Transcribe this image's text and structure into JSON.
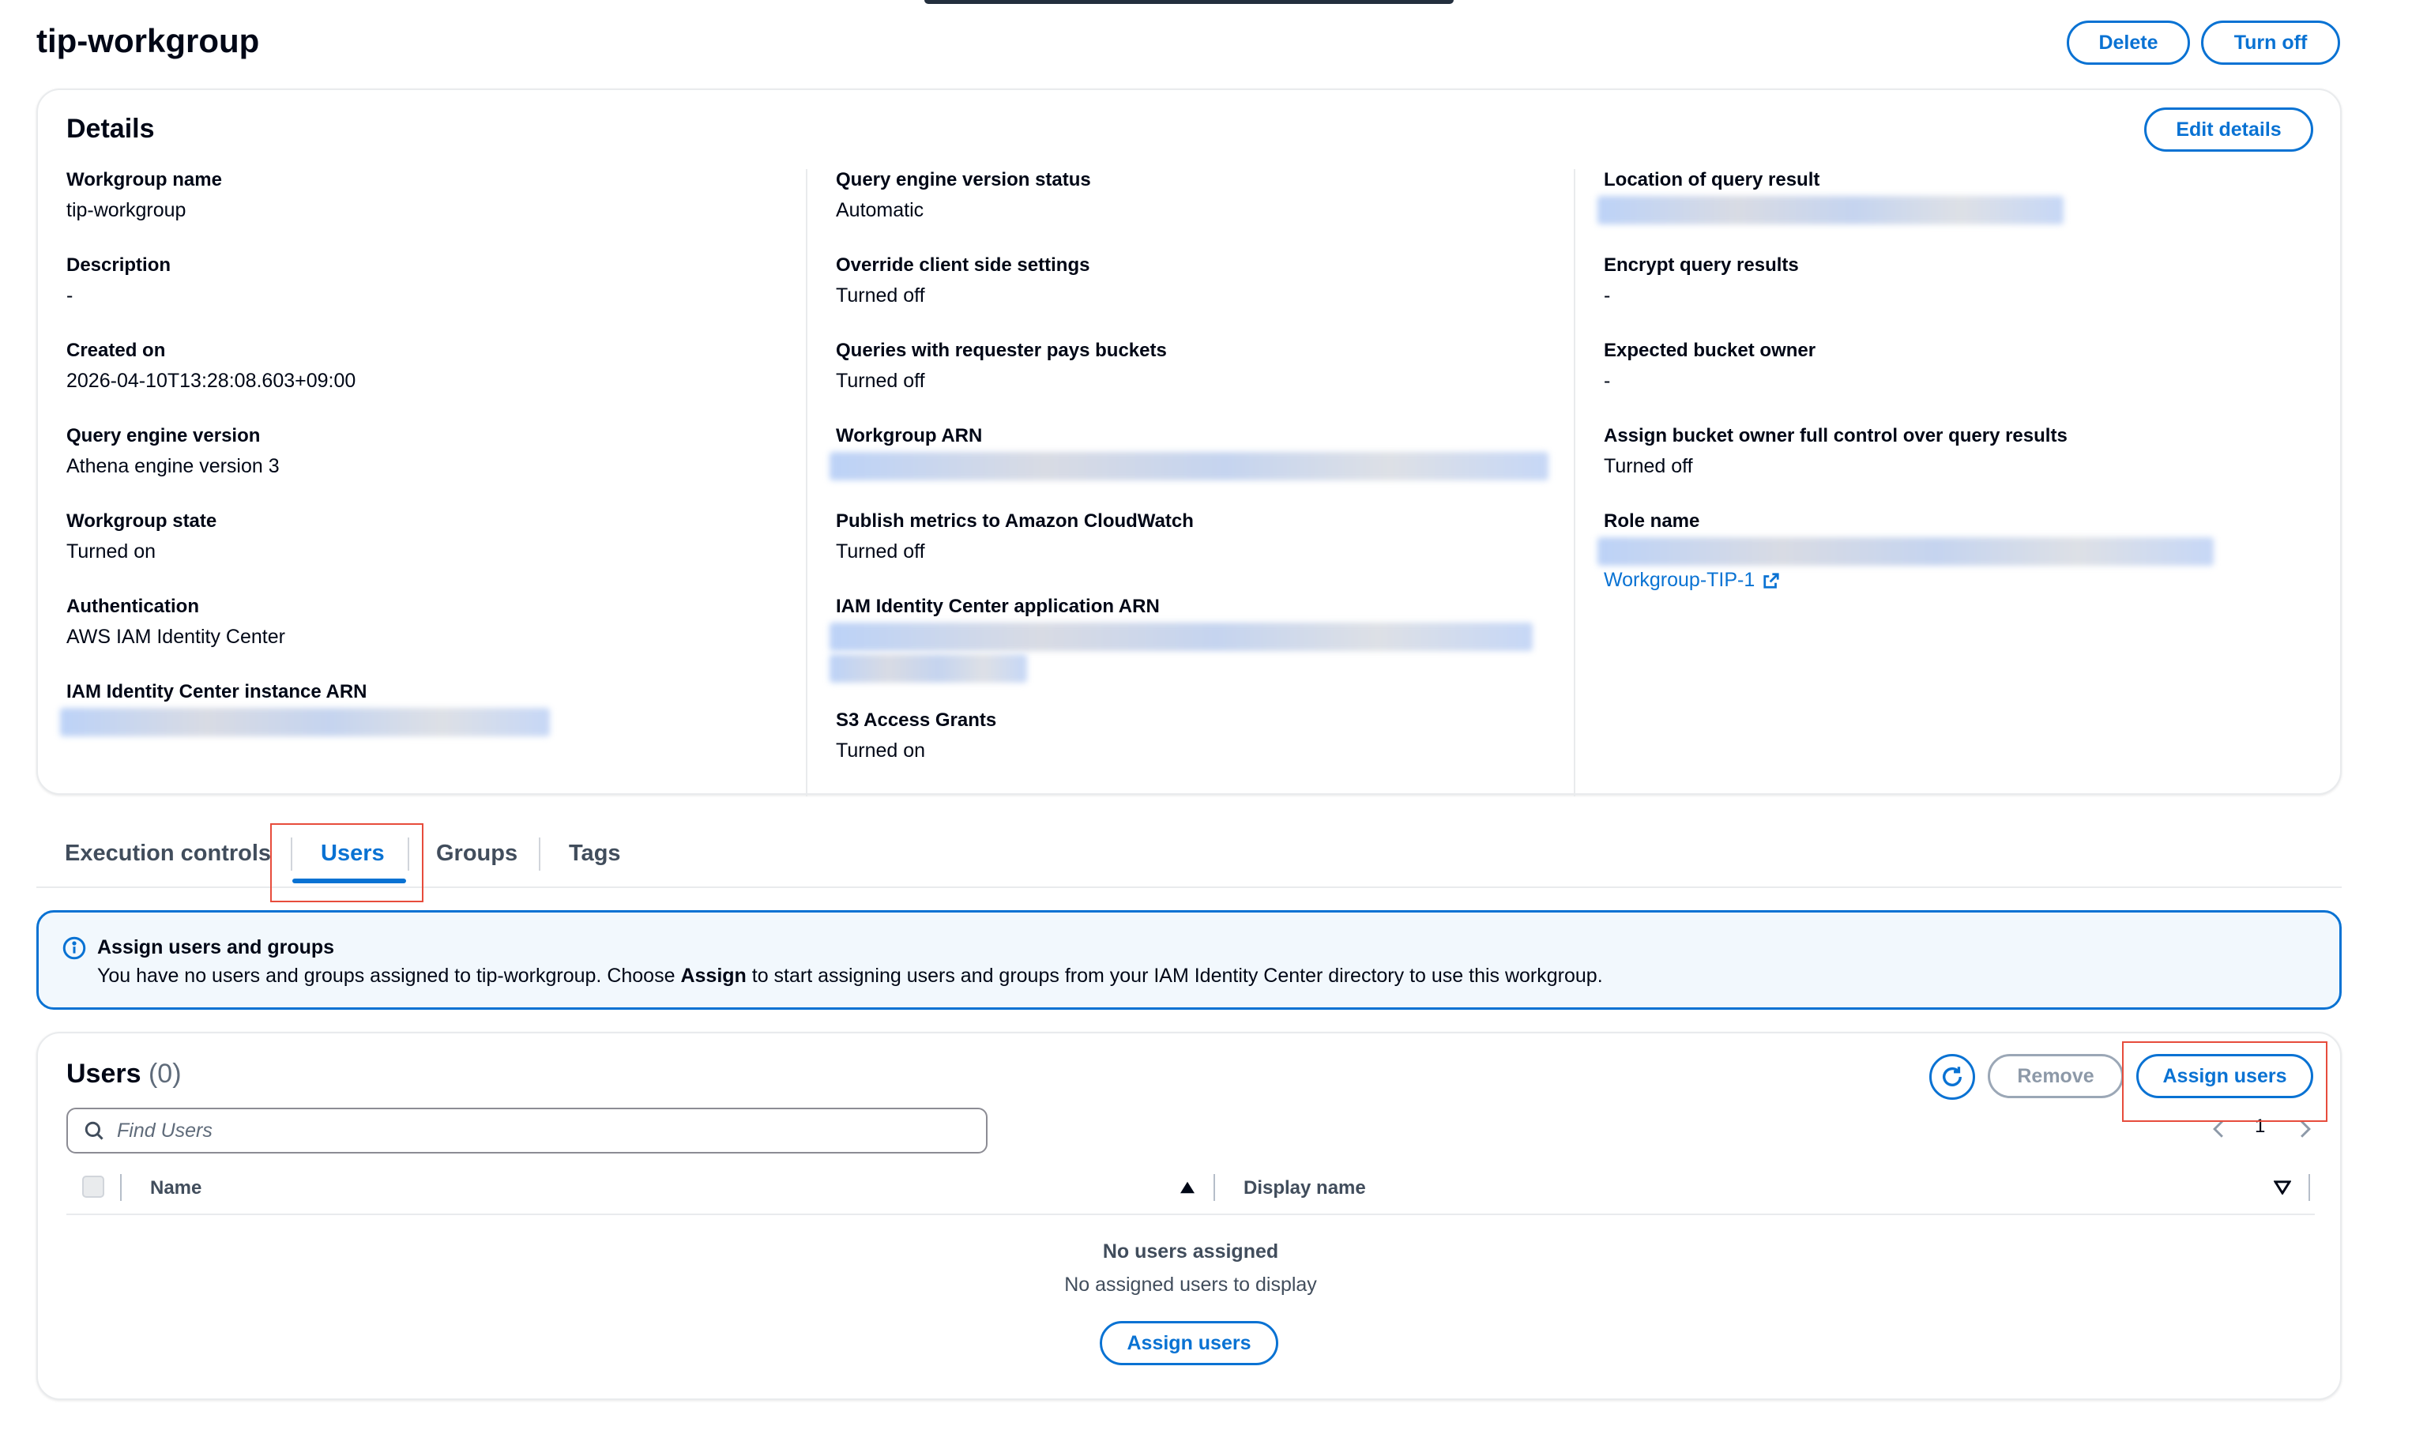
{
  "page": {
    "title": "tip-workgroup",
    "delete_label": "Delete",
    "turn_off_label": "Turn off"
  },
  "details": {
    "heading": "Details",
    "edit_label": "Edit details",
    "col1": [
      {
        "label": "Workgroup name",
        "value": "tip-workgroup"
      },
      {
        "label": "Description",
        "value": "-"
      },
      {
        "label": "Created on",
        "value": "2026-04-10T13:28:08.603+09:00"
      },
      {
        "label": "Query engine version",
        "value": "Athena engine version 3"
      },
      {
        "label": "Workgroup state",
        "value": "Turned on"
      },
      {
        "label": "Authentication",
        "value": "AWS IAM Identity Center"
      },
      {
        "label": "IAM Identity Center instance ARN"
      }
    ],
    "col2": [
      {
        "label": "Query engine version status",
        "value": "Automatic"
      },
      {
        "label": "Override client side settings",
        "value": "Turned off"
      },
      {
        "label": "Queries with requester pays buckets",
        "value": "Turned off"
      },
      {
        "label": "Workgroup ARN"
      },
      {
        "label": "Publish metrics to Amazon CloudWatch",
        "value": "Turned off"
      },
      {
        "label": "IAM Identity Center application ARN"
      },
      {
        "label": "S3 Access Grants",
        "value": "Turned on"
      }
    ],
    "col3": [
      {
        "label": "Location of query result"
      },
      {
        "label": "Encrypt query results",
        "value": "-"
      },
      {
        "label": "Expected bucket owner",
        "value": "-"
      },
      {
        "label": "Assign bucket owner full control over query results",
        "value": "Turned off"
      },
      {
        "label": "Role name",
        "link": "Workgroup-TIP-1"
      }
    ]
  },
  "tabs": [
    {
      "label": "Execution controls"
    },
    {
      "label": "Users",
      "active": true
    },
    {
      "label": "Groups"
    },
    {
      "label": "Tags"
    }
  ],
  "alert": {
    "title": "Assign users and groups",
    "text_before": "You have no users and groups assigned to tip-workgroup. Choose ",
    "text_bold": "Assign",
    "text_after": " to start assigning users and groups from your IAM Identity Center directory to use this workgroup."
  },
  "users": {
    "heading": "Users",
    "count": "(0)",
    "remove_label": "Remove",
    "assign_label": "Assign users",
    "search_placeholder": "Find Users",
    "page_number": "1",
    "columns": [
      "Name",
      "Display name"
    ],
    "empty_title": "No users assigned",
    "empty_subtitle": "No assigned users to display",
    "empty_button": "Assign users"
  },
  "colors": {
    "accent": "#0972d3",
    "highlight_box": "#e74c3c",
    "alert_background": "#f2f8fd"
  },
  "icons": [
    "info-icon",
    "refresh-icon",
    "search-icon",
    "external-link-icon",
    "chevron-left-icon",
    "chevron-right-icon",
    "sort-ascending-icon",
    "sort-descending-icon"
  ]
}
